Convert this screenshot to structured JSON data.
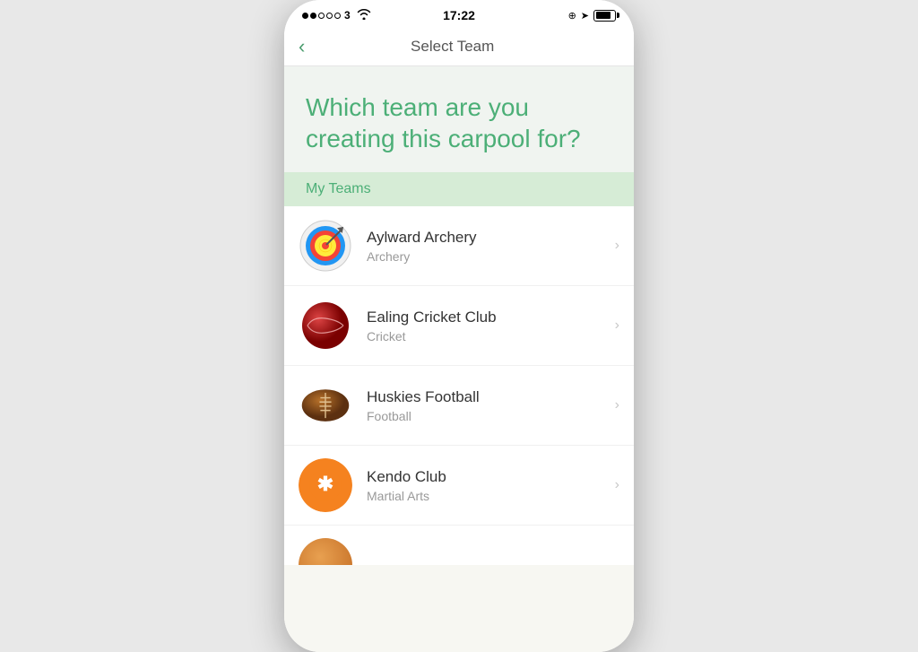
{
  "statusBar": {
    "time": "17:22",
    "signal": "●●○○○ 3",
    "battery": "80"
  },
  "nav": {
    "title": "Select Team",
    "back_label": "‹"
  },
  "hero": {
    "title": "Which team are you creating this carpool for?"
  },
  "myTeams": {
    "section_label": "My Teams"
  },
  "teams": [
    {
      "name": "Aylward Archery",
      "sport": "Archery",
      "icon_type": "archery"
    },
    {
      "name": "Ealing Cricket Club",
      "sport": "Cricket",
      "icon_type": "cricket"
    },
    {
      "name": "Huskies Football",
      "sport": "Football",
      "icon_type": "football"
    },
    {
      "name": "Kendo Club",
      "sport": "Martial Arts",
      "icon_type": "kendo"
    }
  ],
  "colors": {
    "green_accent": "#4caf77",
    "section_bg": "#d6ecd6",
    "hero_bg": "#f0f4f0",
    "chevron": "#c8c8c8"
  }
}
